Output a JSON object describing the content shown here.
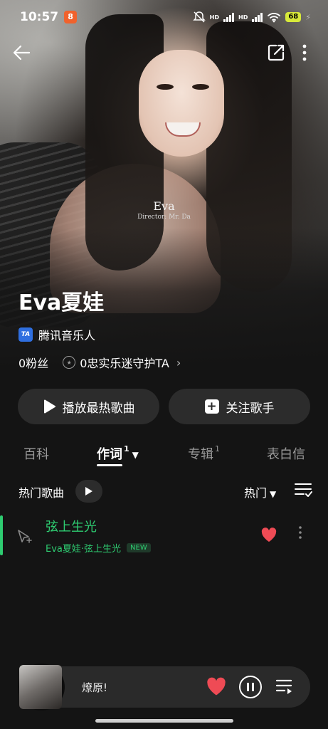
{
  "status_bar": {
    "time": "10:57",
    "app_badge": "8",
    "network_1": "HD",
    "network_2": "HD",
    "battery": "68"
  },
  "hero": {
    "poster_title": "Eva",
    "poster_subtitle": "Director: Mr. Da"
  },
  "artist": {
    "name": "Eva夏娃",
    "verified_label": "腾讯音乐人",
    "verified_badge": "TA",
    "fans": "0粉丝",
    "guard": "0忠实乐迷守护TA"
  },
  "actions": {
    "play_hot": "播放最热歌曲",
    "follow": "关注歌手"
  },
  "tabs": [
    {
      "label": "百科",
      "count": ""
    },
    {
      "label": "作词",
      "count": "1"
    },
    {
      "label": "专辑",
      "count": "1"
    },
    {
      "label": "表白信",
      "count": ""
    }
  ],
  "section": {
    "title": "热门歌曲",
    "sort": "热门"
  },
  "songs": [
    {
      "title": "弦上生光",
      "meta": "Eva夏娃·弦上生光",
      "badge": "NEW"
    }
  ],
  "player": {
    "title": "燎原!"
  },
  "colors": {
    "accent_green": "#2ecc71",
    "heart_red": "#ef4b55",
    "background": "#141414",
    "button_bg": "#2c2c2c"
  }
}
